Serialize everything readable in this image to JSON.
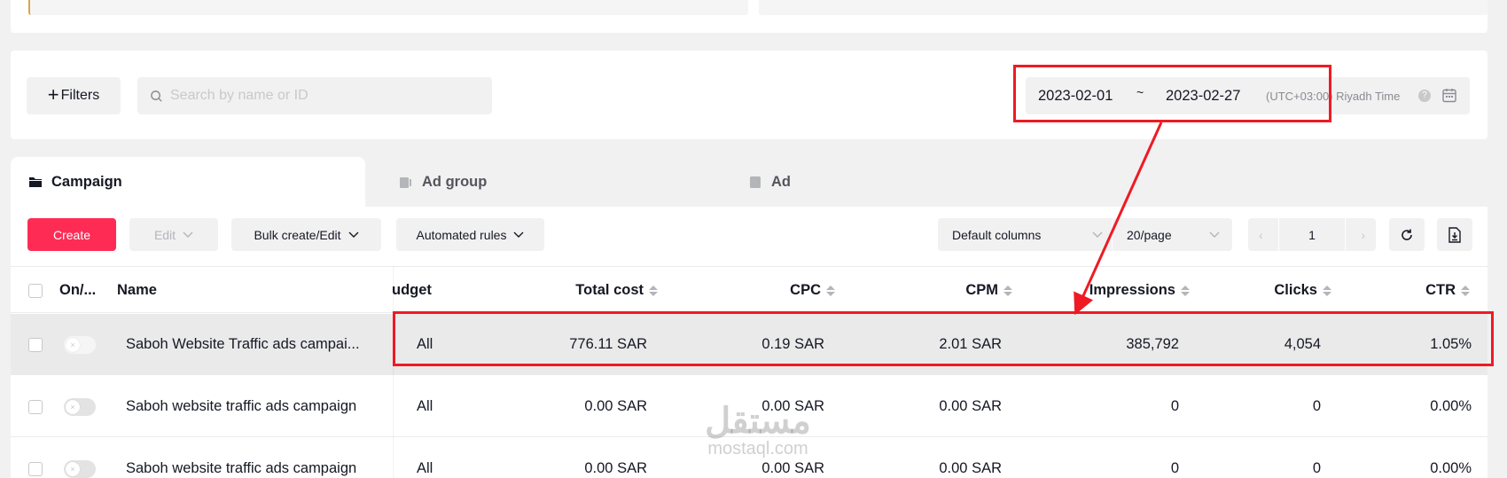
{
  "filters": {
    "filters_label": "Filters",
    "search_placeholder": "Search by name or ID",
    "date_from": "2023-02-01",
    "date_separator": "~",
    "date_to": "2023-02-27",
    "timezone": "(UTC+03:00) Riyadh Time"
  },
  "tabs": [
    {
      "label": "Campaign",
      "icon": "folder-icon",
      "active": true
    },
    {
      "label": "Ad group",
      "icon": "ad-group-icon",
      "active": false
    },
    {
      "label": "Ad",
      "icon": "ad-icon",
      "active": false
    }
  ],
  "toolbar": {
    "create_label": "Create",
    "edit_label": "Edit",
    "bulk_label": "Bulk create/Edit",
    "automated_rules_label": "Automated rules",
    "columns_label": "Default columns",
    "page_size_label": "20/page",
    "page_number": "1"
  },
  "table": {
    "headers": {
      "status": "On/...",
      "name": "Name",
      "budget": "udget",
      "total_cost": "Total cost",
      "cpc": "CPC",
      "cpm": "CPM",
      "impressions": "Impressions",
      "clicks": "Clicks",
      "ctr": "CTR"
    },
    "rows": [
      {
        "name": "Saboh Website Traffic ads campai...",
        "budget": "All",
        "total_cost": "776.11 SAR",
        "cpc": "0.19 SAR",
        "cpm": "2.01 SAR",
        "impressions": "385,792",
        "clicks": "4,054",
        "ctr": "1.05%"
      },
      {
        "name": "Saboh website traffic ads campaign",
        "budget": "All",
        "total_cost": "0.00 SAR",
        "cpc": "0.00 SAR",
        "cpm": "0.00 SAR",
        "impressions": "0",
        "clicks": "0",
        "ctr": "0.00%"
      },
      {
        "name": "Saboh website traffic ads campaign",
        "budget": "All",
        "total_cost": "0.00 SAR",
        "cpc": "0.00 SAR",
        "cpm": "0.00 SAR",
        "impressions": "0",
        "clicks": "0",
        "ctr": "0.00%"
      }
    ]
  },
  "watermark": {
    "arabic": "مستقل",
    "latin": "mostaql.com"
  },
  "colors": {
    "accent": "#fe2c55",
    "annotation": "#ee1b24"
  }
}
